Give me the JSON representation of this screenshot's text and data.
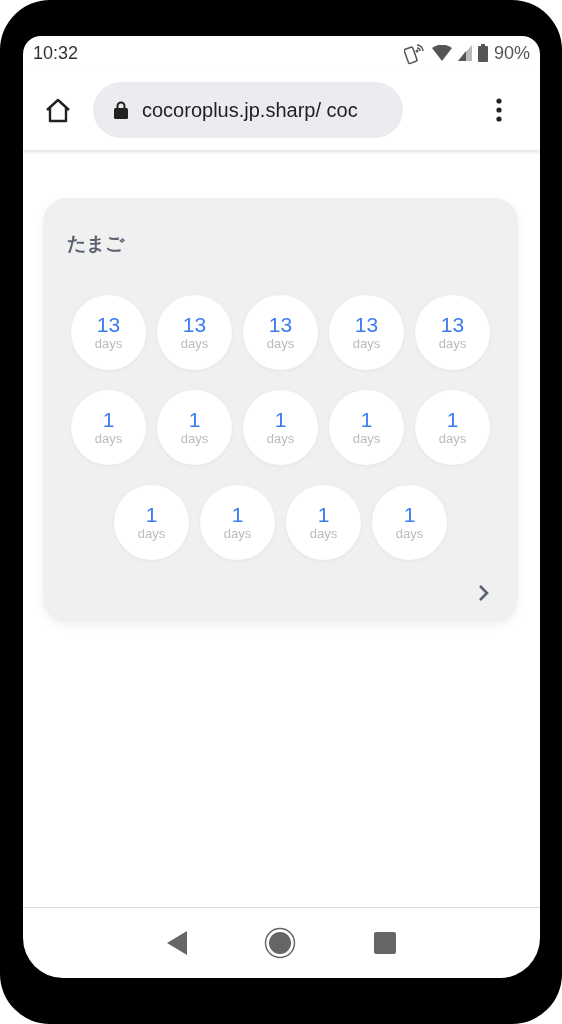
{
  "status_bar": {
    "time": "10:32",
    "battery": "90%"
  },
  "browser": {
    "url": "cocoroplus.jp.sharp/ coc"
  },
  "card": {
    "title": "たまご",
    "counters": [
      {
        "value": "13",
        "unit": "days"
      },
      {
        "value": "13",
        "unit": "days"
      },
      {
        "value": "13",
        "unit": "days"
      },
      {
        "value": "13",
        "unit": "days"
      },
      {
        "value": "13",
        "unit": "days"
      },
      {
        "value": "1",
        "unit": "days"
      },
      {
        "value": "1",
        "unit": "days"
      },
      {
        "value": "1",
        "unit": "days"
      },
      {
        "value": "1",
        "unit": "days"
      },
      {
        "value": "1",
        "unit": "days"
      },
      {
        "value": "1",
        "unit": "days"
      },
      {
        "value": "1",
        "unit": "days"
      },
      {
        "value": "1",
        "unit": "days"
      },
      {
        "value": "1",
        "unit": "days"
      }
    ]
  }
}
